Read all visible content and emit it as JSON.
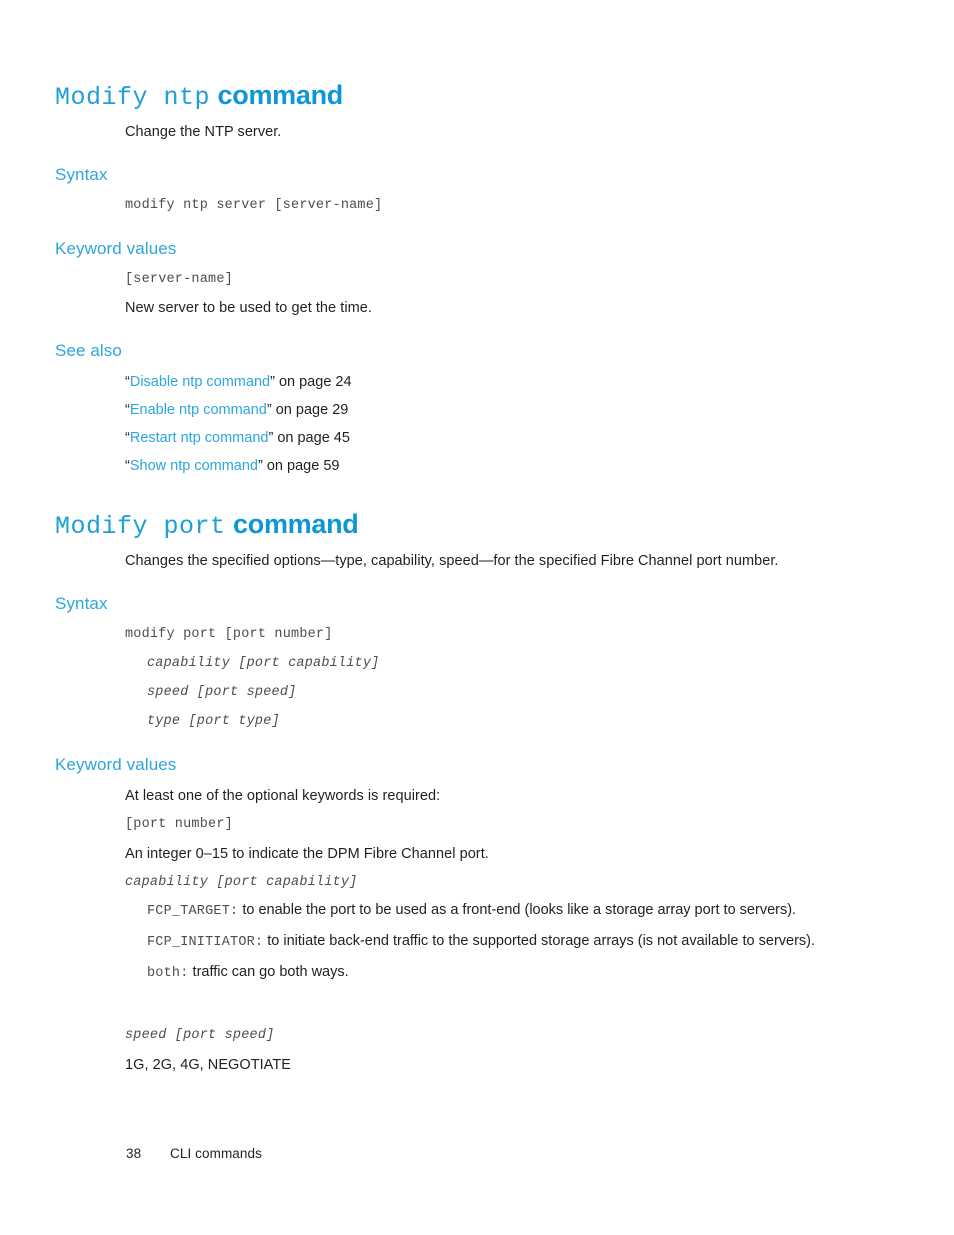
{
  "theme": {
    "accent_blue": "#2ba6de",
    "heading_blue": "#0f9bd7",
    "body_black": "#231f20",
    "code_gray": "#4d4d4d",
    "page_background": "#ffffff"
  },
  "sections": [
    {
      "id": "modify-ntp",
      "heading_mono": "Modify ntp",
      "heading_bold": "command",
      "intro": "Change the NTP server.",
      "syntax_label": "Syntax",
      "syntax_lines": [
        "modify ntp server [server-name]"
      ],
      "keyword_values_label": "Keyword values",
      "keyword_items": [
        {
          "code": "[server-name]",
          "description": "New server to be used to get the time."
        }
      ],
      "see_also_label": "See also",
      "see_also": [
        {
          "open_quote": "“",
          "link": "Disable ntp command",
          "close_quote": "”",
          "suffix": " on page 24"
        },
        {
          "open_quote": "“",
          "link": "Enable ntp command",
          "close_quote": "”",
          "suffix": " on page 29"
        },
        {
          "open_quote": "“",
          "link": "Restart ntp command",
          "close_quote": "”",
          "suffix": " on page 45"
        },
        {
          "open_quote": "“",
          "link": "Show ntp command",
          "close_quote": "”",
          "suffix": " on page 59"
        }
      ]
    },
    {
      "id": "modify-port",
      "heading_mono": "Modify port",
      "heading_bold": "command",
      "intro": "Changes the specified options—type, capability, speed—for the specified Fibre Channel port number.",
      "syntax_label": "Syntax",
      "syntax_lines": [
        "modify port [port number]",
        "capability [port capability]",
        "speed [port speed]",
        "type [port type]"
      ],
      "keyword_values_label": "Keyword values",
      "keyword_intro": "At least one of the optional keywords is required:",
      "port_number_code": "[port number]",
      "port_number_desc": "An integer 0–15 to indicate the DPM Fibre Channel port.",
      "capability_code": "capability [port capability]",
      "capability_values": [
        {
          "keyword": "FCP_TARGET:",
          "description": " to enable the port to be used as a front-end (looks like a storage array port to servers)."
        },
        {
          "keyword": "FCP_INITIATOR:",
          "description": " to initiate back-end traffic to the supported storage arrays (is not available to servers)."
        },
        {
          "keyword": "both:",
          "description": " traffic can go both ways."
        }
      ],
      "speed_code": "speed [port speed]",
      "speed_values": "1G, 2G, 4G, NEGOTIATE"
    }
  ],
  "footer": {
    "page_number": "38",
    "chapter": "CLI commands"
  }
}
